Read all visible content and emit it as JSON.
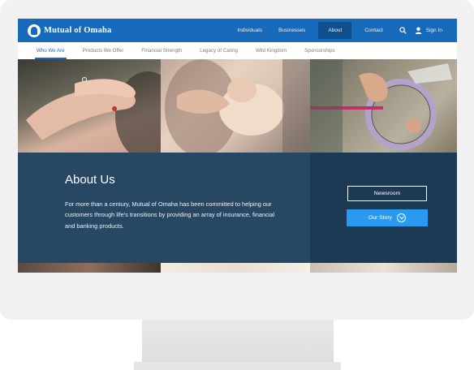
{
  "brand": {
    "name": "Mutual of Omaha"
  },
  "top_nav": {
    "items": [
      {
        "label": "Individuals"
      },
      {
        "label": "Businesses"
      },
      {
        "label": "About"
      },
      {
        "label": "Contact"
      }
    ],
    "search_icon": "search-icon",
    "user_icon": "user-icon",
    "sign_in": "Sign In"
  },
  "sub_nav": {
    "items": [
      {
        "label": "Who We Are"
      },
      {
        "label": "Products We Offer"
      },
      {
        "label": "Financial Strength"
      },
      {
        "label": "Legacy of Caring"
      },
      {
        "label": "Wild Kingdom"
      },
      {
        "label": "Sponsorships"
      }
    ]
  },
  "hero": {
    "title": "About Us",
    "description": "For more than a century, Mutual of Omaha has been committed to helping our customers through life's transitions by providing an array of insurance, financial and banking products.",
    "newsroom_button": "Newsroom",
    "our_story_button": "Our Story"
  },
  "colors": {
    "topbar": "#1769b9",
    "active_tab": "#0f4e8f",
    "panel_left": "#274763",
    "panel_right": "#1d3a55",
    "primary_button": "#2a9af0"
  }
}
